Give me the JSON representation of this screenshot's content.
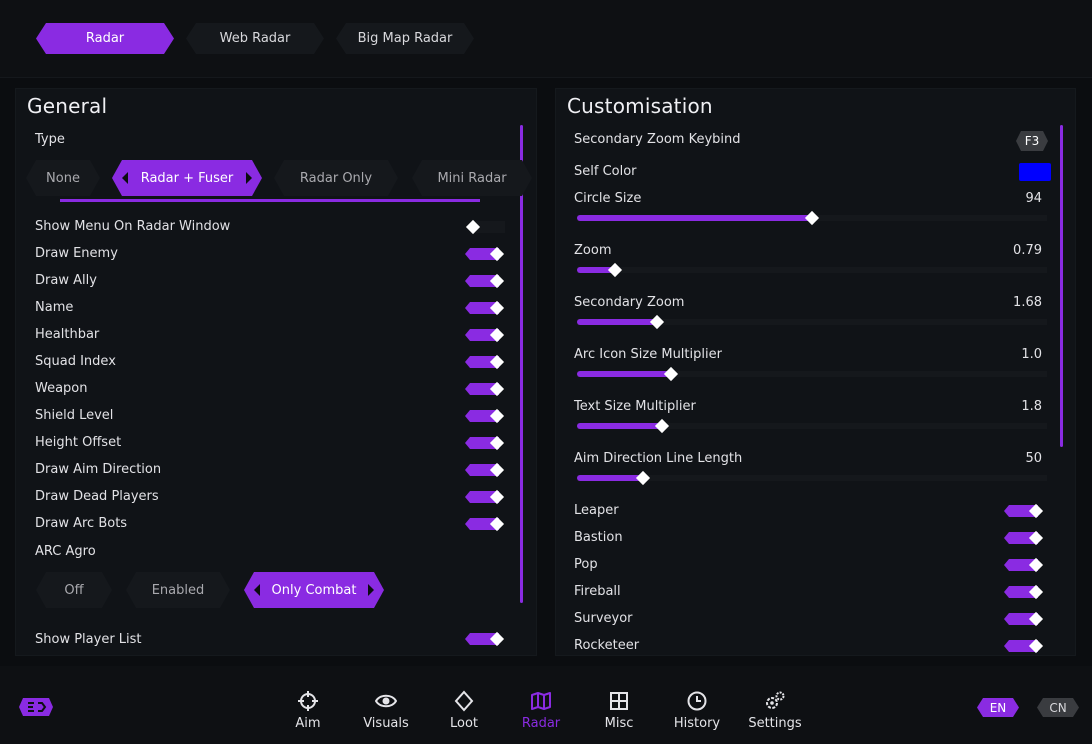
{
  "top_tabs": [
    {
      "label": "Radar",
      "active": true
    },
    {
      "label": "Web Radar",
      "active": false
    },
    {
      "label": "Big Map Radar",
      "active": false
    }
  ],
  "general": {
    "title": "General",
    "type_label": "Type",
    "type_options": [
      "None",
      "Radar + Fuser",
      "Radar Only",
      "Mini Radar"
    ],
    "type_selected": "Radar + Fuser",
    "toggles": [
      {
        "label": "Show Menu On Radar Window",
        "on": false
      },
      {
        "label": "Draw Enemy",
        "on": true
      },
      {
        "label": "Draw Ally",
        "on": true
      },
      {
        "label": "Name",
        "on": true
      },
      {
        "label": "Healthbar",
        "on": true
      },
      {
        "label": "Squad Index",
        "on": true
      },
      {
        "label": "Weapon",
        "on": true
      },
      {
        "label": "Shield Level",
        "on": true
      },
      {
        "label": "Height Offset",
        "on": true
      },
      {
        "label": "Draw Aim Direction",
        "on": true
      },
      {
        "label": "Draw Dead Players",
        "on": true
      },
      {
        "label": "Draw Arc Bots",
        "on": true
      }
    ],
    "arc_agro_label": "ARC Agro",
    "arc_agro_options": [
      "Off",
      "Enabled",
      "Only Combat"
    ],
    "arc_agro_selected": "Only Combat",
    "show_player_list": {
      "label": "Show Player List",
      "on": true
    }
  },
  "customisation": {
    "title": "Customisation",
    "keybind_label": "Secondary Zoom Keybind",
    "keybind_value": "F3",
    "self_color_label": "Self Color",
    "self_color": "#0000ff",
    "sliders": [
      {
        "label": "Circle Size",
        "value": "94",
        "fraction": 0.5
      },
      {
        "label": "Zoom",
        "value": "0.79",
        "fraction": 0.08
      },
      {
        "label": "Secondary Zoom",
        "value": "1.68",
        "fraction": 0.17
      },
      {
        "label": "Arc Icon Size Multiplier",
        "value": "1.0",
        "fraction": 0.2
      },
      {
        "label": "Text Size Multiplier",
        "value": "1.8",
        "fraction": 0.18
      },
      {
        "label": "Aim Direction Line Length",
        "value": "50",
        "fraction": 0.14
      }
    ],
    "toggles": [
      {
        "label": "Leaper",
        "on": true
      },
      {
        "label": "Bastion",
        "on": true
      },
      {
        "label": "Pop",
        "on": true
      },
      {
        "label": "Fireball",
        "on": true
      },
      {
        "label": "Surveyor",
        "on": true
      },
      {
        "label": "Rocketeer",
        "on": true
      }
    ]
  },
  "nav": [
    {
      "label": "Aim",
      "icon": "crosshair-icon",
      "active": false
    },
    {
      "label": "Visuals",
      "icon": "eye-icon",
      "active": false
    },
    {
      "label": "Loot",
      "icon": "diamond-icon",
      "active": false
    },
    {
      "label": "Radar",
      "icon": "map-icon",
      "active": true
    },
    {
      "label": "Misc",
      "icon": "grid-icon",
      "active": false
    },
    {
      "label": "History",
      "icon": "clock-icon",
      "active": false
    },
    {
      "label": "Settings",
      "icon": "gears-icon",
      "active": false
    }
  ],
  "languages": [
    {
      "label": "EN",
      "active": true
    },
    {
      "label": "CN",
      "active": false
    }
  ],
  "colors": {
    "accent": "#8a2be2",
    "background": "#0b0d10",
    "panel": "#101317"
  }
}
